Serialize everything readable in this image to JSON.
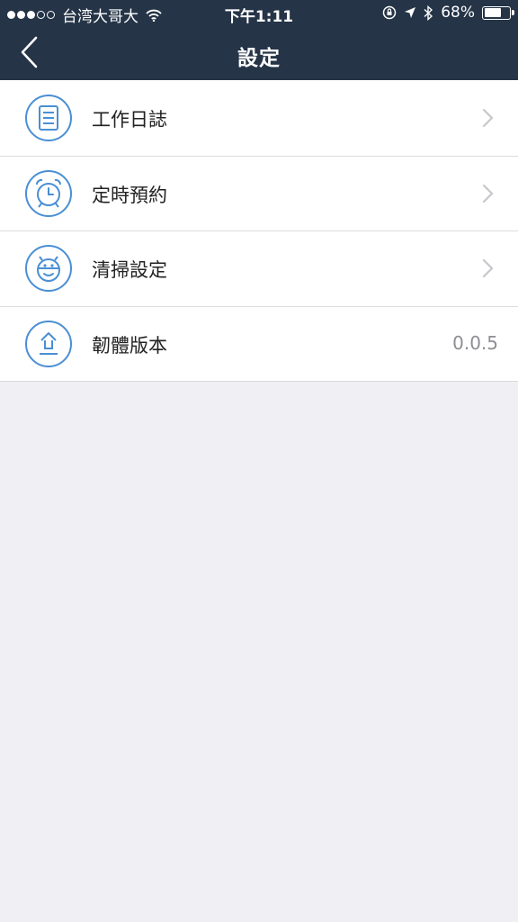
{
  "status_bar": {
    "signal_full": 3,
    "signal_empty": 2,
    "carrier": "台湾大哥大",
    "time": "下午1:11",
    "battery_percent_text": "68%",
    "battery_level": 0.68
  },
  "navbar": {
    "title": "設定",
    "back_icon": "chevron-left-icon"
  },
  "settings": {
    "items": [
      {
        "label": "工作日誌",
        "icon": "document-icon",
        "accessory": "chevron"
      },
      {
        "label": "定時預約",
        "icon": "alarm-clock-icon",
        "accessory": "chevron"
      },
      {
        "label": "清掃設定",
        "icon": "robot-icon",
        "accessory": "chevron"
      },
      {
        "label": "韌體版本",
        "icon": "upload-icon",
        "accessory": "value",
        "value": "0.0.5"
      }
    ]
  },
  "colors": {
    "header_bg": "#253447",
    "accent_icon": "#4a8fd4",
    "page_bg": "#efeff4",
    "chevron": "#c7c7cc",
    "value_text": "#8e8e93"
  }
}
